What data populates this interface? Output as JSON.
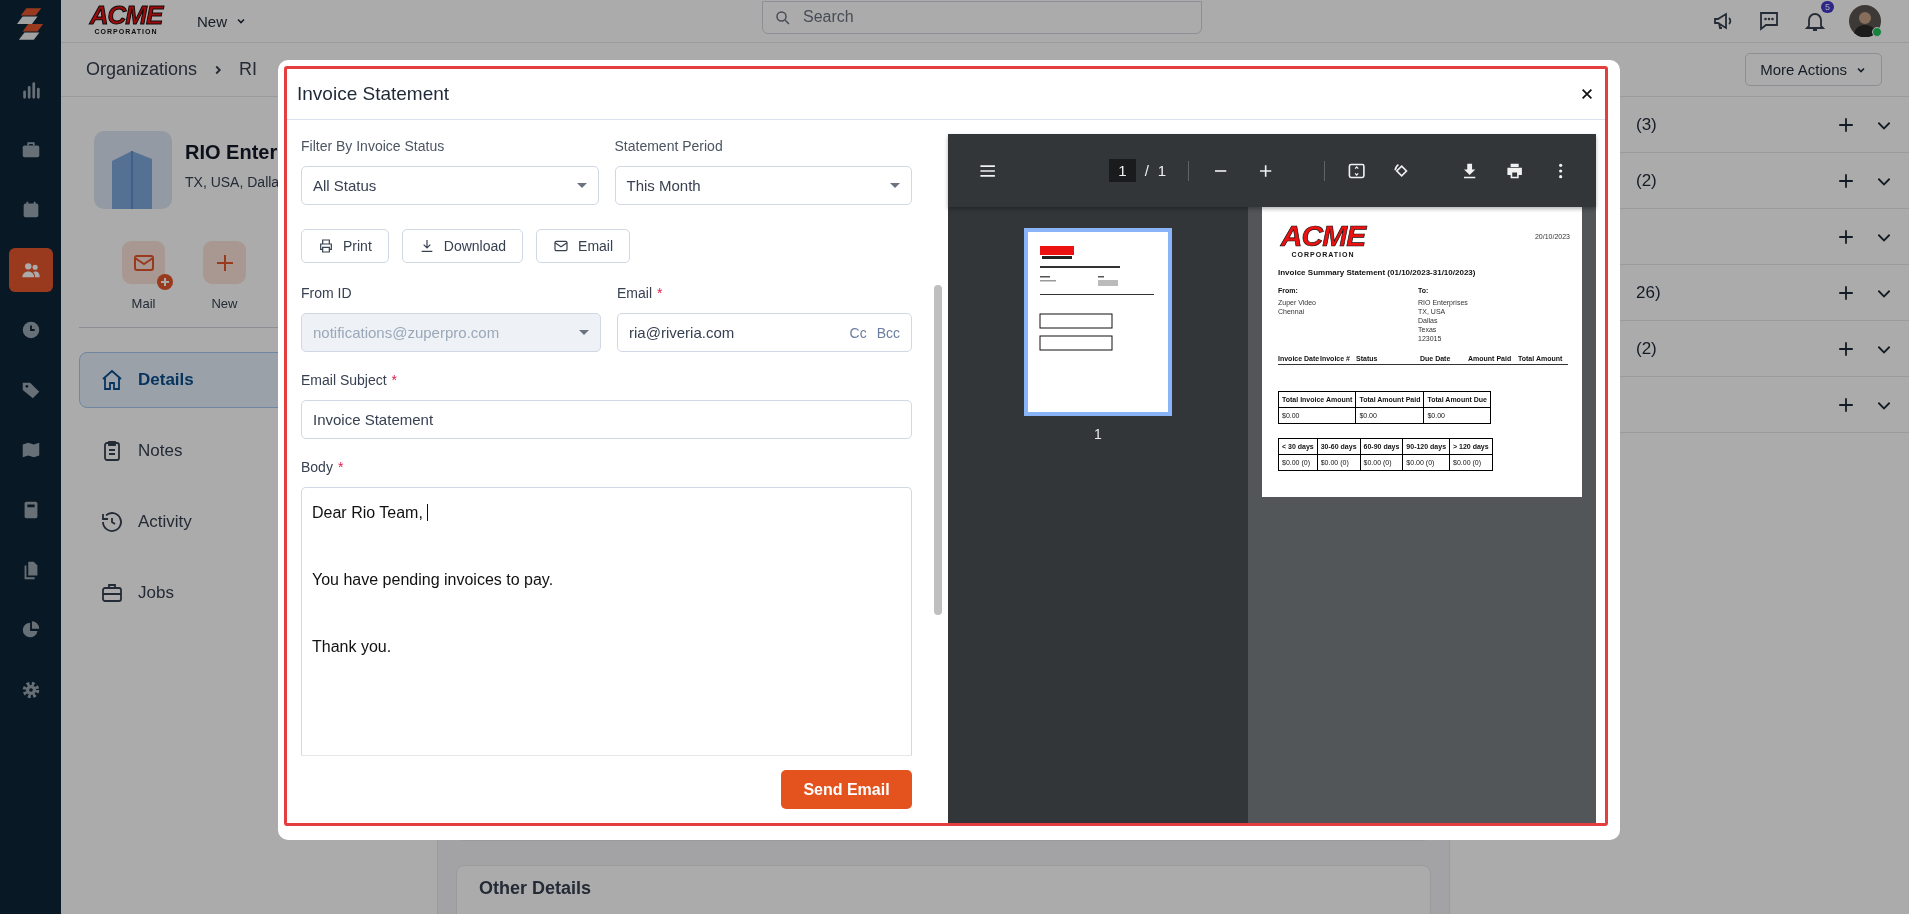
{
  "app_sidebar": {
    "items": [
      {
        "selected": false
      },
      {
        "selected": false
      },
      {
        "selected": false
      },
      {
        "selected": true
      },
      {
        "selected": false
      },
      {
        "selected": false
      },
      {
        "selected": false
      },
      {
        "selected": false
      },
      {
        "selected": false
      },
      {
        "selected": false
      },
      {
        "selected": false
      }
    ]
  },
  "top_bar": {
    "logo_word": "ACME",
    "logo_sub": "CORPORATION",
    "new_menu": "New",
    "search": {
      "placeholder": "Search"
    },
    "notification_count": "5"
  },
  "breadcrumb": [
    "Organizations",
    "RI"
  ],
  "more_actions": "More Actions",
  "organization": {
    "name": "RIO Enter",
    "address": "TX, USA, Dalla",
    "actions": [
      "Mail",
      "New"
    ],
    "nav": [
      {
        "label": "Details",
        "selected": true
      },
      {
        "label": "Notes",
        "selected": false
      },
      {
        "label": "Activity",
        "selected": false
      },
      {
        "label": "Jobs",
        "selected": false
      }
    ]
  },
  "side_sections": [
    {
      "count": "(3)",
      "expanded": false
    },
    {
      "count": "(2)",
      "expanded": false
    },
    {
      "expanded": false
    },
    {
      "count": "26)",
      "expanded": false
    },
    {
      "count": "(2)",
      "expanded": false
    },
    {
      "expanded": false
    }
  ],
  "other_details": "Other Details",
  "modal": {
    "title": "Invoice Statement",
    "filters": [
      {
        "label": "Filter By Invoice Status",
        "value": "All Status"
      },
      {
        "label": "Statement Period",
        "value": "This Month"
      }
    ],
    "actions": [
      "Print",
      "Download",
      "Email"
    ],
    "from": {
      "label": "From ID",
      "value": "notifications@zuperpro.com",
      "disabled": true
    },
    "to": {
      "label": "Email",
      "required_mark": "*",
      "value": "ria@riveria.com",
      "cc": "Cc",
      "bcc": "Bcc"
    },
    "subject": {
      "label": "Email Subject",
      "required_mark": "*",
      "value": "Invoice Statement"
    },
    "body": {
      "label": "Body",
      "required_mark": "*",
      "lines": [
        "Dear Rio Team,",
        "You have pending invoices to pay.",
        "Thank you."
      ]
    },
    "send": "Send Email",
    "pdf_viewer": {
      "page": "1",
      "separator": "/",
      "total": "1",
      "thumb_label": "1",
      "document": {
        "logo_word": "ACME",
        "logo_sub": "CORPORATION",
        "date": "20/10/2023",
        "title": "Invoice Summary Statement (01/10/2023-31/10/2023)",
        "from": {
          "heading": "From:",
          "lines": [
            "Zuper Video",
            "Chennai"
          ]
        },
        "to": {
          "heading": "To:",
          "lines": [
            "RIO Enterprises",
            "TX, USA",
            "Dallas",
            "Texas",
            "123015"
          ]
        },
        "invoice_columns": [
          "Invoice Date",
          "Invoice #",
          "Status",
          "Due Date",
          "Amount Paid",
          "Total Amount"
        ],
        "totals": {
          "columns": [
            "Total Invoice Amount",
            "Total Amount Paid",
            "Total Amount Due"
          ],
          "values": [
            "$0.00",
            "$0.00",
            "$0.00"
          ]
        },
        "aging": {
          "columns": [
            "< 30 days",
            "30-60 days",
            "60-90 days",
            "90-120 days",
            "> 120 days"
          ],
          "values": [
            "$0.00 (0)",
            "$0.00 (0)",
            "$0.00 (0)",
            "$0.00 (0)",
            "$0.00 (0)"
          ]
        }
      }
    }
  }
}
